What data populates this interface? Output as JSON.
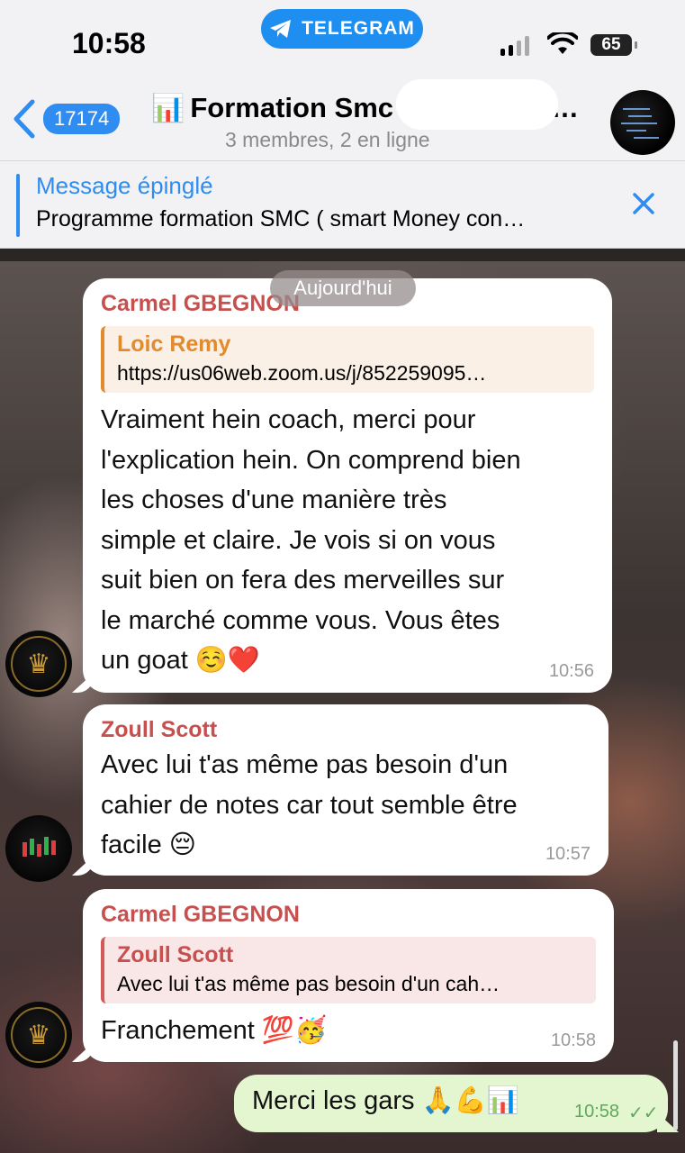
{
  "status_bar": {
    "time": "10:58",
    "app_pill": "TELEGRAM",
    "battery": "65"
  },
  "header": {
    "back_badge": "17174",
    "title_emoji": "📊",
    "title": "Formation Smc",
    "title_tail": "…",
    "subtitle": "3 membres, 2 en ligne"
  },
  "pinned": {
    "label": "Message épinglé",
    "text": "Programme formation SMC ( smart Money con…"
  },
  "date_chip": "Aujourd'hui",
  "messages": [
    {
      "sender": "Carmel GBEGNON",
      "reply_name": "Loic Remy",
      "reply_text": "https://us06web.zoom.us/j/852259095…",
      "lines": [
        "Vraiment hein coach, merci pour",
        "l'explication hein. On comprend bien",
        "les choses d'une manière très",
        "simple et claire. Je vois si on vous",
        "suit bien on fera des merveilles sur",
        "le marché comme vous. Vous êtes",
        "un goat ☺️❤️"
      ],
      "time": "10:56"
    },
    {
      "sender": "Zoull Scott",
      "lines": [
        "Avec lui t'as même pas besoin d'un",
        "cahier de notes car tout semble être",
        "facile 😔"
      ],
      "time": "10:57"
    },
    {
      "sender": "Carmel GBEGNON",
      "reply_name": "Zoull Scott",
      "reply_text": "Avec lui t'as même pas besoin d'un cah…",
      "lines": [
        "Franchement 💯🥳"
      ],
      "time": "10:58"
    }
  ],
  "outgoing": {
    "text": "Merci les gars 🙏💪📊",
    "time": "10:58",
    "status": "✓✓"
  },
  "colors": {
    "accent": "#2f8cf0",
    "sender_red": "#c7504f",
    "reply_orange": "#e28a2e",
    "outgoing_bg": "#e3f6cf"
  }
}
